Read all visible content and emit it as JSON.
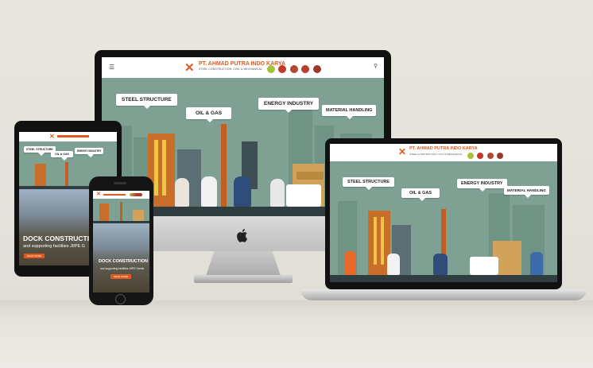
{
  "brand": {
    "name": "PT. AHMAD PUTRA INDO KARYA",
    "tagline": "STEEL CONSTRUCTION, CIVIL & MECHANICAL",
    "accent": "#e05a1e",
    "hero_bg": "#7fa194"
  },
  "nav": {
    "menu_icon": "hamburger-icon",
    "search_icon": "search-icon"
  },
  "hero": {
    "bubbles": [
      "STEEL STRUCTURE",
      "OIL & GAS",
      "ENERGY INDUSTRY",
      "MATERIAL HANDLING"
    ]
  },
  "mobile_slide": {
    "tablet_title": "DOCK CONSTRUCTI",
    "tablet_subtitle": "and supporting facilities JIIPE G",
    "phone_title": "DOCK CONSTRUCTION",
    "phone_subtitle": "and supporting facilities JIIPE Gresik",
    "cta": "READ MORE"
  }
}
